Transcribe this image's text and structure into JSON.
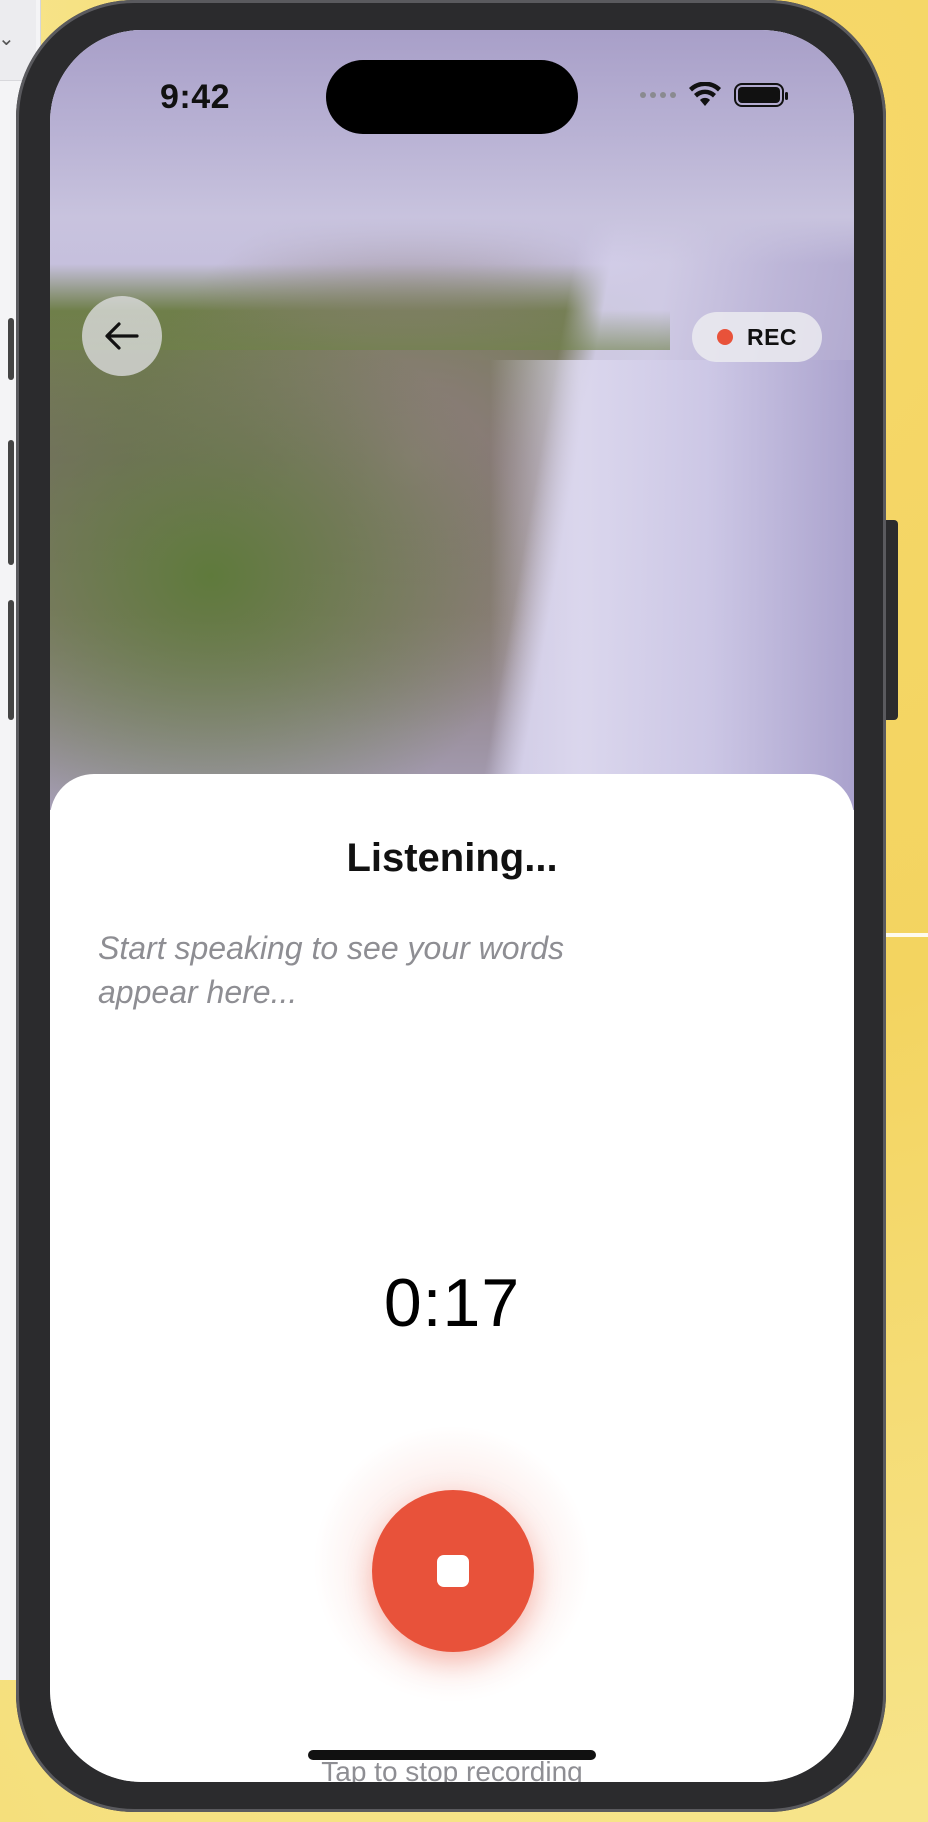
{
  "status_bar": {
    "time": "9:42"
  },
  "header": {
    "rec_label": "REC"
  },
  "sheet": {
    "title": "Listening...",
    "transcript_placeholder": "Start speaking to see your words appear here...",
    "timer": "0:17",
    "hint": "Tap to stop recording"
  },
  "icons": {
    "back": "arrow-left-icon",
    "stop": "stop-icon",
    "wifi": "wifi-icon",
    "battery": "battery-icon",
    "signal": "signal-icon"
  },
  "colors": {
    "accent": "#e8523a",
    "text_primary": "#111111",
    "text_secondary": "#8e8e93"
  }
}
